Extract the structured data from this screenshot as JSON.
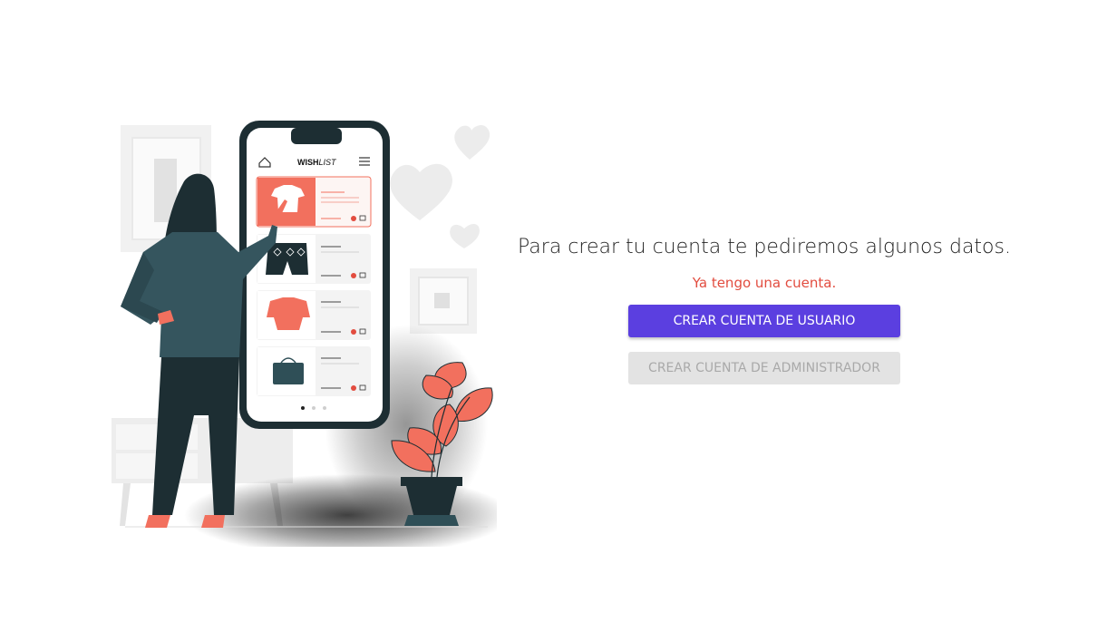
{
  "illustration": {
    "app_name_bold": "WISH",
    "app_name_italic": "LIST"
  },
  "main": {
    "headline": "Para crear tu cuenta te pediremos algunos datos.",
    "login_link": "Ya tengo una cuenta.",
    "create_user_button": "CREAR CUENTA DE USUARIO",
    "create_admin_button": "CREAR CUENTA DE ADMINISTRADOR"
  },
  "colors": {
    "primary": "#5b3fe0",
    "accent": "#e24c3f",
    "disabled_bg": "#e3e3e3",
    "disabled_text": "#a9a9a9",
    "illustration_coral": "#f2705e",
    "illustration_dark": "#1d2e33"
  }
}
